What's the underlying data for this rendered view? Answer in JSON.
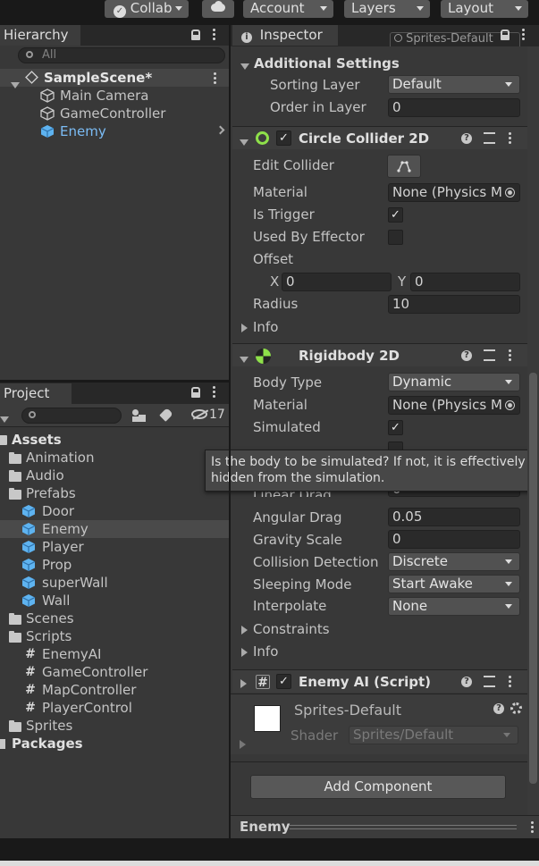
{
  "toolbar": {
    "collab": "Collab",
    "account": "Account",
    "layers": "Layers",
    "layout": "Layout"
  },
  "hierarchy": {
    "tab": "Hierarchy",
    "search_placeholder": "All",
    "scene": "SampleScene*",
    "items": [
      "Main Camera",
      "GameController",
      "Enemy"
    ]
  },
  "project": {
    "tab": "Project",
    "badge": "17",
    "tree": [
      {
        "label": "Assets",
        "level": 0,
        "kind": "root"
      },
      {
        "label": "Animation",
        "level": 1,
        "kind": "folder"
      },
      {
        "label": "Audio",
        "level": 1,
        "kind": "folder"
      },
      {
        "label": "Prefabs",
        "level": 1,
        "kind": "folder"
      },
      {
        "label": "Door",
        "level": 2,
        "kind": "prefab"
      },
      {
        "label": "Enemy",
        "level": 2,
        "kind": "prefab"
      },
      {
        "label": "Player",
        "level": 2,
        "kind": "prefab"
      },
      {
        "label": "Prop",
        "level": 2,
        "kind": "prefab"
      },
      {
        "label": "superWall",
        "level": 2,
        "kind": "prefab"
      },
      {
        "label": "Wall",
        "level": 2,
        "kind": "prefab"
      },
      {
        "label": "Scenes",
        "level": 1,
        "kind": "folder"
      },
      {
        "label": "Scripts",
        "level": 1,
        "kind": "folder"
      },
      {
        "label": "EnemyAI",
        "level": 2,
        "kind": "script"
      },
      {
        "label": "GameController",
        "level": 2,
        "kind": "script"
      },
      {
        "label": "MapController",
        "level": 2,
        "kind": "script"
      },
      {
        "label": "PlayerControl",
        "level": 2,
        "kind": "script"
      },
      {
        "label": "Sprites",
        "level": 1,
        "kind": "folder"
      },
      {
        "label": "Packages",
        "level": 0,
        "kind": "root"
      }
    ]
  },
  "inspector": {
    "tab": "Inspector",
    "top_partial": "Sprites-Default",
    "additional": {
      "title": "Additional Settings",
      "sorting_layer_label": "Sorting Layer",
      "sorting_layer_value": "Default",
      "order_label": "Order in Layer",
      "order_value": "0"
    },
    "circle": {
      "title": "Circle Collider 2D",
      "edit_label": "Edit Collider",
      "material_label": "Material",
      "material_value": "None (Physics M",
      "trigger_label": "Is Trigger",
      "effector_label": "Used By Effector",
      "offset_label": "Offset",
      "offset_x_label": "X",
      "offset_x": "0",
      "offset_y_label": "Y",
      "offset_y": "0",
      "radius_label": "Radius",
      "radius_value": "10",
      "info_label": "Info"
    },
    "rigidbody": {
      "title": "Rigidbody 2D",
      "body_type_label": "Body Type",
      "body_type_value": "Dynamic",
      "material_label": "Material",
      "material_value": "None (Physics M",
      "simulated_label": "Simulated",
      "linear_drag_label": "Linear Drag",
      "linear_drag_value": "0",
      "angular_drag_label": "Angular Drag",
      "angular_drag_value": "0.05",
      "gravity_label": "Gravity Scale",
      "gravity_value": "0",
      "collision_label": "Collision Detection",
      "collision_value": "Discrete",
      "sleeping_label": "Sleeping Mode",
      "sleeping_value": "Start Awake",
      "interpolate_label": "Interpolate",
      "interpolate_value": "None",
      "constraints_label": "Constraints",
      "info_label": "Info"
    },
    "tooltip": "Is the body to be simulated? If not, it is effectively hidden from the simulation.",
    "script": {
      "title": "Enemy AI (Script)"
    },
    "material": {
      "name": "Sprites-Default",
      "shader_label": "Shader",
      "shader_value": "Sprites/Default"
    },
    "add_component": "Add Component",
    "footer": "Enemy"
  }
}
